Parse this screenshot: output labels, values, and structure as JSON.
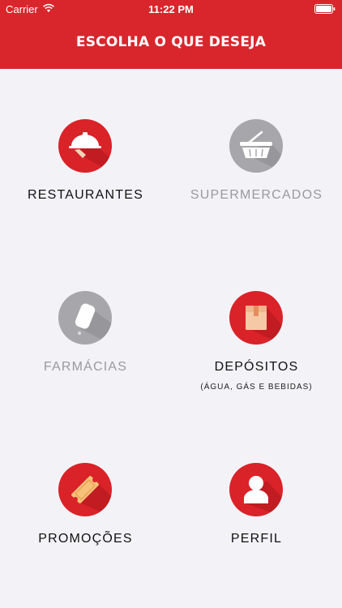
{
  "status_bar": {
    "carrier": "Carrier",
    "time": "11:22 PM"
  },
  "header": {
    "title": "ESCOLHA O QUE DESEJA",
    "color": "#d9262c"
  },
  "menu": [
    {
      "label": "RESTAURANTES",
      "icon": "waiter-cloche-icon",
      "enabled": true
    },
    {
      "label": "SUPERMERCADOS",
      "icon": "shopping-basket-icon",
      "enabled": false
    },
    {
      "label": "FARMÁCIAS",
      "icon": "medicine-icon",
      "enabled": false
    },
    {
      "label": "DEPÓSITOS",
      "sublabel": "(ÁGUA, GÁS E BEBIDAS)",
      "icon": "box-icon",
      "enabled": true
    },
    {
      "label": "PROMOÇÕES",
      "icon": "ticket-icon",
      "enabled": true
    },
    {
      "label": "PERFIL",
      "icon": "user-profile-icon",
      "enabled": true
    }
  ]
}
